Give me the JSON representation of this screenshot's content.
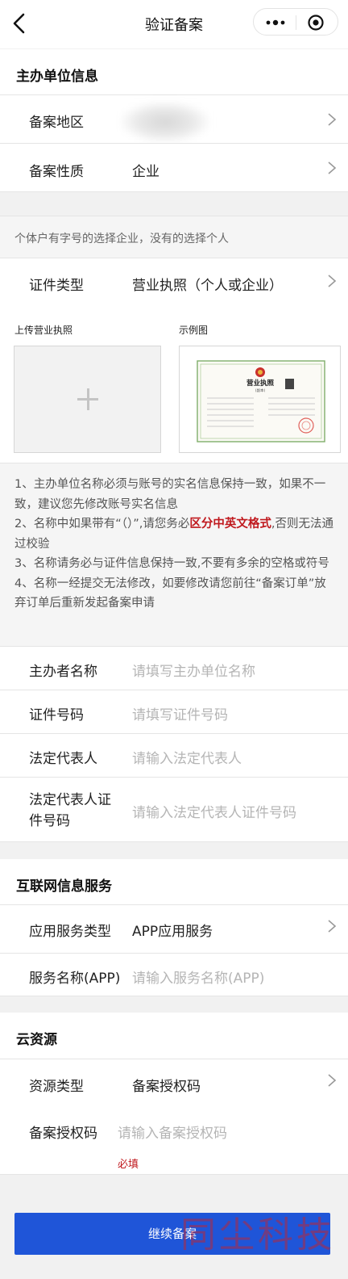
{
  "nav": {
    "title": "验证备案"
  },
  "sponsor": {
    "heading": "主办单位信息",
    "region_label": "备案地区",
    "nature_label": "备案性质",
    "nature_value": "企业"
  },
  "hint": "个体户有字号的选择企业，没有的选择个人",
  "cert": {
    "type_label": "证件类型",
    "type_value": "营业执照（个人或企业）"
  },
  "upload": {
    "upload_caption": "上传营业执照",
    "sample_caption": "示例图"
  },
  "sample_license": {
    "title": "营业执照",
    "sub": "(副本)"
  },
  "notes": {
    "n1": "1、主办单位名称必须与账号的实名信息保持一致，如果不一致，建议您先修改账号实名信息",
    "n2_a": "2、名称中如果带有“（）”,请您务必",
    "n2_red": "区分中英文格式",
    "n2_b": ",否则无法通过校验",
    "n3": "3、名称请务必与证件信息保持一致,不要有多余的空格或符号",
    "n4": "4、名称一经提交无法修改，如要修改请您前往“备案订单”放弃订单后重新发起备案申请"
  },
  "form": {
    "owner_label": "主办者名称",
    "owner_placeholder": "请填写主办单位名称",
    "certno_label": "证件号码",
    "certno_placeholder": "请填写证件号码",
    "legal_label": "法定代表人",
    "legal_placeholder": "请输入法定代表人",
    "legal_id_label_1": "法定代表人证",
    "legal_id_label_2": "件号码",
    "legal_id_placeholder": "请输入法定代表人证件号码"
  },
  "internet": {
    "heading": "互联网信息服务",
    "svc_type_label": "应用服务类型",
    "svc_type_value": "APP应用服务",
    "svc_name_label": "服务名称(APP)",
    "svc_name_placeholder": "请输入服务名称(APP)"
  },
  "cloud": {
    "heading": "云资源",
    "res_type_label": "资源类型",
    "res_type_value": "备案授权码",
    "auth_label": "备案授权码",
    "auth_placeholder": "请输入备案授权码",
    "required": "必填"
  },
  "submit_label": "继续备案",
  "watermark": "同尘科技",
  "colors": {
    "primary": "#1f55d8",
    "warning_red": "#c0191e",
    "placeholder": "#b5b5b5"
  }
}
